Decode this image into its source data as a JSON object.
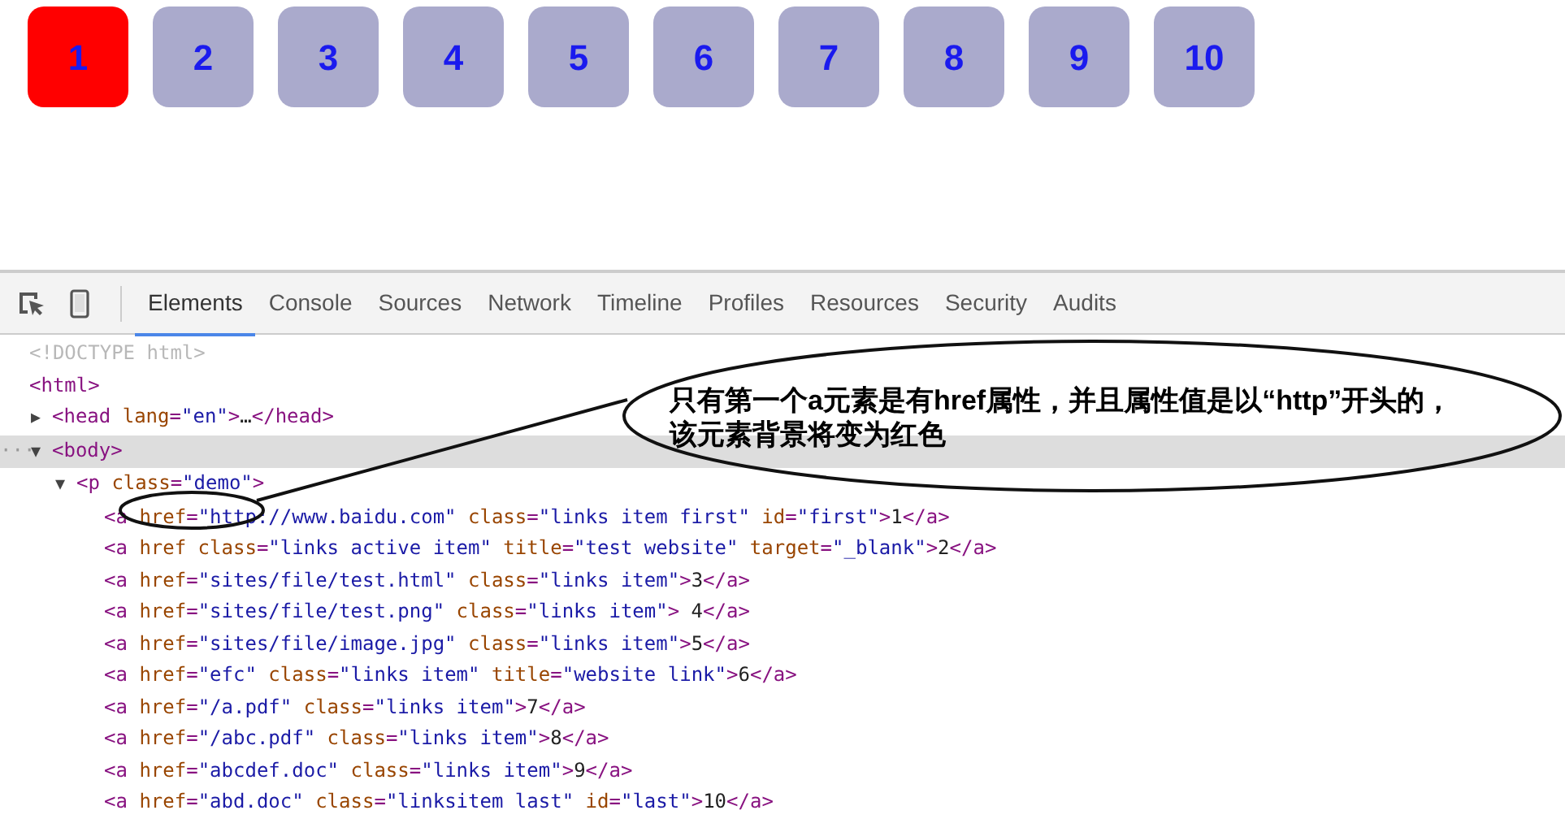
{
  "demo_boxes": [
    {
      "label": "1",
      "selected": true
    },
    {
      "label": "2",
      "selected": false
    },
    {
      "label": "3",
      "selected": false
    },
    {
      "label": "4",
      "selected": false
    },
    {
      "label": "5",
      "selected": false
    },
    {
      "label": "6",
      "selected": false
    },
    {
      "label": "7",
      "selected": false
    },
    {
      "label": "8",
      "selected": false
    },
    {
      "label": "9",
      "selected": false
    },
    {
      "label": "10",
      "selected": false
    }
  ],
  "devtools": {
    "tabs": [
      {
        "label": "Elements",
        "selected": true
      },
      {
        "label": "Console",
        "selected": false
      },
      {
        "label": "Sources",
        "selected": false
      },
      {
        "label": "Network",
        "selected": false
      },
      {
        "label": "Timeline",
        "selected": false
      },
      {
        "label": "Profiles",
        "selected": false
      },
      {
        "label": "Resources",
        "selected": false
      },
      {
        "label": "Security",
        "selected": false
      },
      {
        "label": "Audits",
        "selected": false
      }
    ],
    "dom_tree": [
      {
        "highlighted": false,
        "segments": [
          {
            "kind": "doctype",
            "text": "<!DOCTYPE html>"
          }
        ]
      },
      {
        "highlighted": false,
        "segments": [
          {
            "kind": "tag",
            "text": "<html>"
          }
        ],
        "children": [
          {
            "toggle": "▶",
            "highlighted": false,
            "segments": [
              {
                "kind": "tag",
                "text": "<head "
              },
              {
                "kind": "attr",
                "text": "lang"
              },
              {
                "kind": "tag",
                "text": "="
              },
              {
                "kind": "value",
                "text": "\"en\""
              },
              {
                "kind": "tag",
                "text": ">"
              },
              {
                "kind": "text",
                "text": "…"
              },
              {
                "kind": "tag",
                "text": "</head>"
              }
            ]
          },
          {
            "toggle": "▼",
            "highlighted": true,
            "marker": "···",
            "segments": [
              {
                "kind": "tag",
                "text": "<body>"
              }
            ],
            "children": [
              {
                "toggle": "▼",
                "highlighted": false,
                "segments": [
                  {
                    "kind": "tag",
                    "text": "<p "
                  },
                  {
                    "kind": "attr",
                    "text": "class"
                  },
                  {
                    "kind": "tag",
                    "text": "="
                  },
                  {
                    "kind": "value",
                    "text": "\"demo\""
                  },
                  {
                    "kind": "tag",
                    "text": ">"
                  }
                ],
                "children": [
                  {
                    "highlighted": false,
                    "segments": [
                      {
                        "kind": "tag",
                        "text": "<a "
                      },
                      {
                        "kind": "attr",
                        "text": "href"
                      },
                      {
                        "kind": "tag",
                        "text": "="
                      },
                      {
                        "kind": "value",
                        "text": "\"http://www.baidu.com\""
                      },
                      {
                        "kind": "attr",
                        "text": " class"
                      },
                      {
                        "kind": "tag",
                        "text": "="
                      },
                      {
                        "kind": "value",
                        "text": "\"links item first\""
                      },
                      {
                        "kind": "attr",
                        "text": " id"
                      },
                      {
                        "kind": "tag",
                        "text": "="
                      },
                      {
                        "kind": "value",
                        "text": "\"first\""
                      },
                      {
                        "kind": "tag",
                        "text": ">"
                      },
                      {
                        "kind": "text",
                        "text": "1"
                      },
                      {
                        "kind": "tag",
                        "text": "</a>"
                      }
                    ]
                  },
                  {
                    "highlighted": false,
                    "segments": [
                      {
                        "kind": "tag",
                        "text": "<a "
                      },
                      {
                        "kind": "attr",
                        "text": "href class"
                      },
                      {
                        "kind": "tag",
                        "text": "="
                      },
                      {
                        "kind": "value",
                        "text": "\"links active item\""
                      },
                      {
                        "kind": "attr",
                        "text": " title"
                      },
                      {
                        "kind": "tag",
                        "text": "="
                      },
                      {
                        "kind": "value",
                        "text": "\"test website\""
                      },
                      {
                        "kind": "attr",
                        "text": " target"
                      },
                      {
                        "kind": "tag",
                        "text": "="
                      },
                      {
                        "kind": "value",
                        "text": "\"_blank\""
                      },
                      {
                        "kind": "tag",
                        "text": ">"
                      },
                      {
                        "kind": "text",
                        "text": "2"
                      },
                      {
                        "kind": "tag",
                        "text": "</a>"
                      }
                    ]
                  },
                  {
                    "highlighted": false,
                    "segments": [
                      {
                        "kind": "tag",
                        "text": "<a "
                      },
                      {
                        "kind": "attr",
                        "text": "href"
                      },
                      {
                        "kind": "tag",
                        "text": "="
                      },
                      {
                        "kind": "value",
                        "text": "\"sites/file/test.html\""
                      },
                      {
                        "kind": "attr",
                        "text": " class"
                      },
                      {
                        "kind": "tag",
                        "text": "="
                      },
                      {
                        "kind": "value",
                        "text": "\"links item\""
                      },
                      {
                        "kind": "tag",
                        "text": ">"
                      },
                      {
                        "kind": "text",
                        "text": "3"
                      },
                      {
                        "kind": "tag",
                        "text": "</a>"
                      }
                    ]
                  },
                  {
                    "highlighted": false,
                    "segments": [
                      {
                        "kind": "tag",
                        "text": "<a "
                      },
                      {
                        "kind": "attr",
                        "text": "href"
                      },
                      {
                        "kind": "tag",
                        "text": "="
                      },
                      {
                        "kind": "value",
                        "text": "\"sites/file/test.png\""
                      },
                      {
                        "kind": "attr",
                        "text": " class"
                      },
                      {
                        "kind": "tag",
                        "text": "="
                      },
                      {
                        "kind": "value",
                        "text": "\"links item\""
                      },
                      {
                        "kind": "tag",
                        "text": ">"
                      },
                      {
                        "kind": "text",
                        "text": " 4"
                      },
                      {
                        "kind": "tag",
                        "text": "</a>"
                      }
                    ]
                  },
                  {
                    "highlighted": false,
                    "segments": [
                      {
                        "kind": "tag",
                        "text": "<a "
                      },
                      {
                        "kind": "attr",
                        "text": "href"
                      },
                      {
                        "kind": "tag",
                        "text": "="
                      },
                      {
                        "kind": "value",
                        "text": "\"sites/file/image.jpg\""
                      },
                      {
                        "kind": "attr",
                        "text": " class"
                      },
                      {
                        "kind": "tag",
                        "text": "="
                      },
                      {
                        "kind": "value",
                        "text": "\"links item\""
                      },
                      {
                        "kind": "tag",
                        "text": ">"
                      },
                      {
                        "kind": "text",
                        "text": "5"
                      },
                      {
                        "kind": "tag",
                        "text": "</a>"
                      }
                    ]
                  },
                  {
                    "highlighted": false,
                    "segments": [
                      {
                        "kind": "tag",
                        "text": "<a "
                      },
                      {
                        "kind": "attr",
                        "text": "href"
                      },
                      {
                        "kind": "tag",
                        "text": "="
                      },
                      {
                        "kind": "value",
                        "text": "\"efc\""
                      },
                      {
                        "kind": "attr",
                        "text": " class"
                      },
                      {
                        "kind": "tag",
                        "text": "="
                      },
                      {
                        "kind": "value",
                        "text": "\"links item\""
                      },
                      {
                        "kind": "attr",
                        "text": " title"
                      },
                      {
                        "kind": "tag",
                        "text": "="
                      },
                      {
                        "kind": "value",
                        "text": "\"website link\""
                      },
                      {
                        "kind": "tag",
                        "text": ">"
                      },
                      {
                        "kind": "text",
                        "text": "6"
                      },
                      {
                        "kind": "tag",
                        "text": "</a>"
                      }
                    ]
                  },
                  {
                    "highlighted": false,
                    "segments": [
                      {
                        "kind": "tag",
                        "text": "<a "
                      },
                      {
                        "kind": "attr",
                        "text": "href"
                      },
                      {
                        "kind": "tag",
                        "text": "="
                      },
                      {
                        "kind": "value",
                        "text": "\"/a.pdf\""
                      },
                      {
                        "kind": "attr",
                        "text": " class"
                      },
                      {
                        "kind": "tag",
                        "text": "="
                      },
                      {
                        "kind": "value",
                        "text": "\"links item\""
                      },
                      {
                        "kind": "tag",
                        "text": ">"
                      },
                      {
                        "kind": "text",
                        "text": "7"
                      },
                      {
                        "kind": "tag",
                        "text": "</a>"
                      }
                    ]
                  },
                  {
                    "highlighted": false,
                    "segments": [
                      {
                        "kind": "tag",
                        "text": "<a "
                      },
                      {
                        "kind": "attr",
                        "text": "href"
                      },
                      {
                        "kind": "tag",
                        "text": "="
                      },
                      {
                        "kind": "value",
                        "text": "\"/abc.pdf\""
                      },
                      {
                        "kind": "attr",
                        "text": " class"
                      },
                      {
                        "kind": "tag",
                        "text": "="
                      },
                      {
                        "kind": "value",
                        "text": "\"links item\""
                      },
                      {
                        "kind": "tag",
                        "text": ">"
                      },
                      {
                        "kind": "text",
                        "text": "8"
                      },
                      {
                        "kind": "tag",
                        "text": "</a>"
                      }
                    ]
                  },
                  {
                    "highlighted": false,
                    "segments": [
                      {
                        "kind": "tag",
                        "text": "<a "
                      },
                      {
                        "kind": "attr",
                        "text": "href"
                      },
                      {
                        "kind": "tag",
                        "text": "="
                      },
                      {
                        "kind": "value",
                        "text": "\"abcdef.doc\""
                      },
                      {
                        "kind": "attr",
                        "text": " class"
                      },
                      {
                        "kind": "tag",
                        "text": "="
                      },
                      {
                        "kind": "value",
                        "text": "\"links item\""
                      },
                      {
                        "kind": "tag",
                        "text": ">"
                      },
                      {
                        "kind": "text",
                        "text": "9"
                      },
                      {
                        "kind": "tag",
                        "text": "</a>"
                      }
                    ]
                  },
                  {
                    "highlighted": false,
                    "segments": [
                      {
                        "kind": "tag",
                        "text": "<a "
                      },
                      {
                        "kind": "attr",
                        "text": "href"
                      },
                      {
                        "kind": "tag",
                        "text": "="
                      },
                      {
                        "kind": "value",
                        "text": "\"abd.doc\""
                      },
                      {
                        "kind": "attr",
                        "text": " class"
                      },
                      {
                        "kind": "tag",
                        "text": "="
                      },
                      {
                        "kind": "value",
                        "text": "\"linksitem last\""
                      },
                      {
                        "kind": "attr",
                        "text": " id"
                      },
                      {
                        "kind": "tag",
                        "text": "="
                      },
                      {
                        "kind": "value",
                        "text": "\"last\""
                      },
                      {
                        "kind": "tag",
                        "text": ">"
                      },
                      {
                        "kind": "text",
                        "text": "10"
                      },
                      {
                        "kind": "tag",
                        "text": "</a>"
                      }
                    ]
                  }
                ]
              }
            ]
          }
        ]
      }
    ]
  },
  "callout": {
    "text": "只有第一个a元素是有href属性，并且属性值是以“http”开头的，该元素背景将变为红色"
  }
}
